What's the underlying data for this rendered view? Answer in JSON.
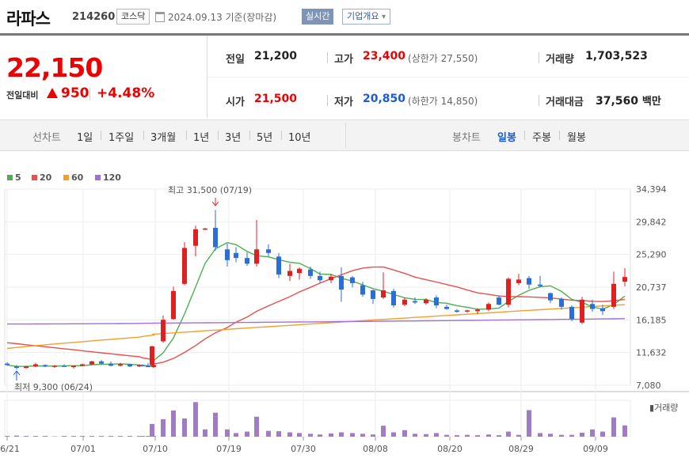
{
  "header": {
    "stock_name": "라파스",
    "stock_code": "214260",
    "market": "코스닥",
    "date": "2024.09.13 기준(장마감)",
    "live_button": "실시간",
    "overview_button": "기업개요",
    "overview_arrow": "▾"
  },
  "price": {
    "current": "22,150",
    "change_label": "전일대비",
    "change_value": "950",
    "change_pct": "+4.48%",
    "direction": "up"
  },
  "stats": {
    "prev_close_label": "전일",
    "prev_close": "21,200",
    "high_label": "고가",
    "high": "23,400",
    "upper_limit_label": "상한가",
    "upper_limit": "27,550",
    "volume_label": "거래량",
    "volume": "1,703,523",
    "open_label": "시가",
    "open": "21,500",
    "low_label": "저가",
    "low": "20,850",
    "lower_limit_label": "하한가",
    "lower_limit": "14,850",
    "amount_label": "거래대금",
    "amount": "37,560",
    "amount_unit": "백만"
  },
  "period_bar": {
    "line_chart_label": "선차트",
    "line_periods": [
      "1일",
      "1주일",
      "3개월",
      "1년",
      "3년",
      "5년",
      "10년"
    ],
    "candle_chart_label": "봉차트",
    "candle_periods": [
      "일봉",
      "주봉",
      "월봉"
    ],
    "selected_candle": "일봉"
  },
  "legend": [
    {
      "label": "5",
      "color": "#4caf50"
    },
    {
      "label": "20",
      "color": "#e8504a"
    },
    {
      "label": "60",
      "color": "#f0a030"
    },
    {
      "label": "120",
      "color": "#a46fd0"
    }
  ],
  "colors": {
    "up": "#e02020",
    "down": "#2a6fd6",
    "volume": "#a07cc5"
  },
  "chart_data": {
    "type": "candlestick",
    "y_ticks": [
      "34,394",
      "29,842",
      "25,290",
      "20,737",
      "16,185",
      "11,632",
      "7,080"
    ],
    "ylim": [
      7080,
      34394
    ],
    "x_labels": [
      "06/21",
      "07/01",
      "07/10",
      "07/19",
      "07/30",
      "08/08",
      "08/20",
      "08/29",
      "09/09"
    ],
    "max_annotation": "최고 31,500 (07/19)",
    "min_annotation": "최저 9,300 (06/24)",
    "volume_label": "거래량",
    "candles": [
      {
        "o": 10100,
        "h": 10300,
        "l": 9800,
        "c": 9900
      },
      {
        "o": 9700,
        "h": 9900,
        "l": 9300,
        "c": 9500
      },
      {
        "o": 9500,
        "h": 9800,
        "l": 9400,
        "c": 9700
      },
      {
        "o": 9700,
        "h": 10200,
        "l": 9600,
        "c": 10000
      },
      {
        "o": 9900,
        "h": 10000,
        "l": 9600,
        "c": 9700
      },
      {
        "o": 9700,
        "h": 9900,
        "l": 9500,
        "c": 9800
      },
      {
        "o": 9800,
        "h": 10000,
        "l": 9700,
        "c": 9700
      },
      {
        "o": 9600,
        "h": 9800,
        "l": 9400,
        "c": 9800
      },
      {
        "o": 9800,
        "h": 10100,
        "l": 9700,
        "c": 10000
      },
      {
        "o": 10000,
        "h": 10500,
        "l": 9900,
        "c": 10400
      },
      {
        "o": 10400,
        "h": 10600,
        "l": 10000,
        "c": 10100
      },
      {
        "o": 10100,
        "h": 10400,
        "l": 9700,
        "c": 9800
      },
      {
        "o": 9800,
        "h": 10200,
        "l": 9700,
        "c": 10000
      },
      {
        "o": 10000,
        "h": 10100,
        "l": 9600,
        "c": 9700
      },
      {
        "o": 9700,
        "h": 10000,
        "l": 9600,
        "c": 9900
      },
      {
        "o": 9900,
        "h": 10000,
        "l": 9700,
        "c": 9800
      },
      {
        "o": 9800,
        "h": 10200,
        "l": 9700,
        "c": 9600
      },
      {
        "o": 9600,
        "h": 10000,
        "l": 9500,
        "c": 9900
      },
      {
        "o": 9900,
        "h": 12600,
        "l": 9800,
        "c": 12500
      },
      {
        "o": 13200,
        "h": 16800,
        "l": 13000,
        "c": 16200
      },
      {
        "o": 16300,
        "h": 20800,
        "l": 16200,
        "c": 20200
      },
      {
        "o": 21200,
        "h": 27000,
        "l": 21000,
        "c": 26200
      },
      {
        "o": 26500,
        "h": 29300,
        "l": 25000,
        "c": 28800
      },
      {
        "o": 28800,
        "h": 29000,
        "l": 28700,
        "c": 28900
      },
      {
        "o": 29000,
        "h": 31500,
        "l": 25800,
        "c": 26300
      },
      {
        "o": 26000,
        "h": 26800,
        "l": 23600,
        "c": 24500
      },
      {
        "o": 25500,
        "h": 26300,
        "l": 24200,
        "c": 24800
      },
      {
        "o": 24800,
        "h": 25600,
        "l": 23700,
        "c": 24000
      },
      {
        "o": 24000,
        "h": 30100,
        "l": 23600,
        "c": 26000
      },
      {
        "o": 26000,
        "h": 26700,
        "l": 25000,
        "c": 25500
      },
      {
        "o": 25000,
        "h": 25500,
        "l": 22000,
        "c": 22500
      },
      {
        "o": 22300,
        "h": 24000,
        "l": 21600,
        "c": 23000
      },
      {
        "o": 22700,
        "h": 23500,
        "l": 21800,
        "c": 23300
      },
      {
        "o": 23200,
        "h": 23600,
        "l": 21900,
        "c": 22300
      },
      {
        "o": 22300,
        "h": 22900,
        "l": 21300,
        "c": 21700
      },
      {
        "o": 21700,
        "h": 22600,
        "l": 21300,
        "c": 22200
      },
      {
        "o": 22300,
        "h": 23500,
        "l": 18700,
        "c": 20400
      },
      {
        "o": 22100,
        "h": 22300,
        "l": 20700,
        "c": 21300
      },
      {
        "o": 21000,
        "h": 21500,
        "l": 19400,
        "c": 19700
      },
      {
        "o": 20300,
        "h": 20400,
        "l": 18400,
        "c": 19100
      },
      {
        "o": 19300,
        "h": 22800,
        "l": 19100,
        "c": 20300
      },
      {
        "o": 20200,
        "h": 20500,
        "l": 17900,
        "c": 18200
      },
      {
        "o": 18300,
        "h": 19300,
        "l": 18100,
        "c": 19000
      },
      {
        "o": 18800,
        "h": 19300,
        "l": 18400,
        "c": 18600
      },
      {
        "o": 18500,
        "h": 19200,
        "l": 18300,
        "c": 19000
      },
      {
        "o": 19300,
        "h": 19600,
        "l": 17800,
        "c": 18200
      },
      {
        "o": 18000,
        "h": 18300,
        "l": 17600,
        "c": 17700
      },
      {
        "o": 17500,
        "h": 17700,
        "l": 17200,
        "c": 17300
      },
      {
        "o": 17400,
        "h": 17600,
        "l": 17200,
        "c": 17500
      },
      {
        "o": 17400,
        "h": 17800,
        "l": 17000,
        "c": 17600
      },
      {
        "o": 17600,
        "h": 18600,
        "l": 17400,
        "c": 18400
      },
      {
        "o": 19300,
        "h": 19600,
        "l": 18200,
        "c": 18300
      },
      {
        "o": 18300,
        "h": 22100,
        "l": 17900,
        "c": 21900
      },
      {
        "o": 21300,
        "h": 22600,
        "l": 21000,
        "c": 21800
      },
      {
        "o": 22000,
        "h": 22300,
        "l": 20500,
        "c": 21100
      },
      {
        "o": 21100,
        "h": 22300,
        "l": 20700,
        "c": 20900
      },
      {
        "o": 19900,
        "h": 20000,
        "l": 18500,
        "c": 18900
      },
      {
        "o": 19100,
        "h": 19300,
        "l": 17600,
        "c": 18000
      },
      {
        "o": 18000,
        "h": 18200,
        "l": 16000,
        "c": 16300
      },
      {
        "o": 15800,
        "h": 19400,
        "l": 15600,
        "c": 19000
      },
      {
        "o": 18400,
        "h": 19000,
        "l": 17300,
        "c": 17700
      },
      {
        "o": 17800,
        "h": 18300,
        "l": 16900,
        "c": 17400
      },
      {
        "o": 18000,
        "h": 22900,
        "l": 17700,
        "c": 21200
      },
      {
        "o": 21500,
        "h": 23400,
        "l": 20850,
        "c": 22150
      }
    ],
    "volumes": [
      0.02,
      0.03,
      0.02,
      0.02,
      0.02,
      0.01,
      0.02,
      0.02,
      0.02,
      0.02,
      0.02,
      0.02,
      0.02,
      0.02,
      0.02,
      0.02,
      0.02,
      0.02,
      0.35,
      0.48,
      0.72,
      0.5,
      0.95,
      0.2,
      0.66,
      0.2,
      0.1,
      0.14,
      0.55,
      0.16,
      0.15,
      0.12,
      0.1,
      0.08,
      0.06,
      0.09,
      0.12,
      0.1,
      0.08,
      0.06,
      0.3,
      0.12,
      0.18,
      0.08,
      0.07,
      0.1,
      0.05,
      0.04,
      0.05,
      0.04,
      0.06,
      0.04,
      0.14,
      0.05,
      0.73,
      0.1,
      0.08,
      0.05,
      0.05,
      0.11,
      0.2,
      0.14,
      0.53,
      0.31
    ]
  }
}
